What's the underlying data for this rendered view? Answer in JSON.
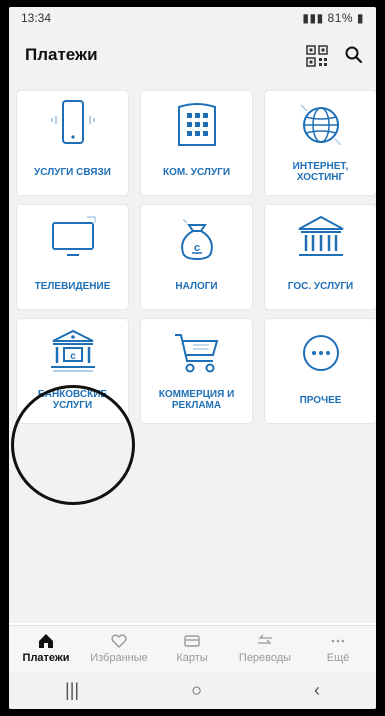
{
  "status_bar": {
    "time": "13:34",
    "battery": "81%"
  },
  "header": {
    "title": "Платежи"
  },
  "tiles": [
    {
      "label": "УСЛУГИ СВЯЗИ",
      "icon": "phone-icon"
    },
    {
      "label": "КОМ. УСЛУГИ",
      "icon": "building-icon"
    },
    {
      "label": "ИНТЕРНЕТ, ХОСТИНГ",
      "icon": "globe-icon"
    },
    {
      "label": "ТЕЛЕВИДЕНИЕ",
      "icon": "tv-icon"
    },
    {
      "label": "НАЛОГИ",
      "icon": "money-bag-icon"
    },
    {
      "label": "ГОС. УСЛУГИ",
      "icon": "government-building-icon"
    },
    {
      "label": "БАНКОВСКИЕ УСЛУГИ",
      "icon": "bank-icon"
    },
    {
      "label": "КОММЕРЦИЯ И РЕКЛАМА",
      "icon": "shopping-cart-icon"
    },
    {
      "label": "ПРОЧЕЕ",
      "icon": "more-dots-icon"
    }
  ],
  "bottom_nav": [
    {
      "label": "Платежи",
      "active": true
    },
    {
      "label": "Избранные",
      "active": false
    },
    {
      "label": "Карты",
      "active": false
    },
    {
      "label": "Переводы",
      "active": false
    },
    {
      "label": "Ещё",
      "active": false
    }
  ],
  "colors": {
    "accent": "#1f6fb7",
    "background": "#f2f2f2",
    "tile": "#ffffff"
  }
}
